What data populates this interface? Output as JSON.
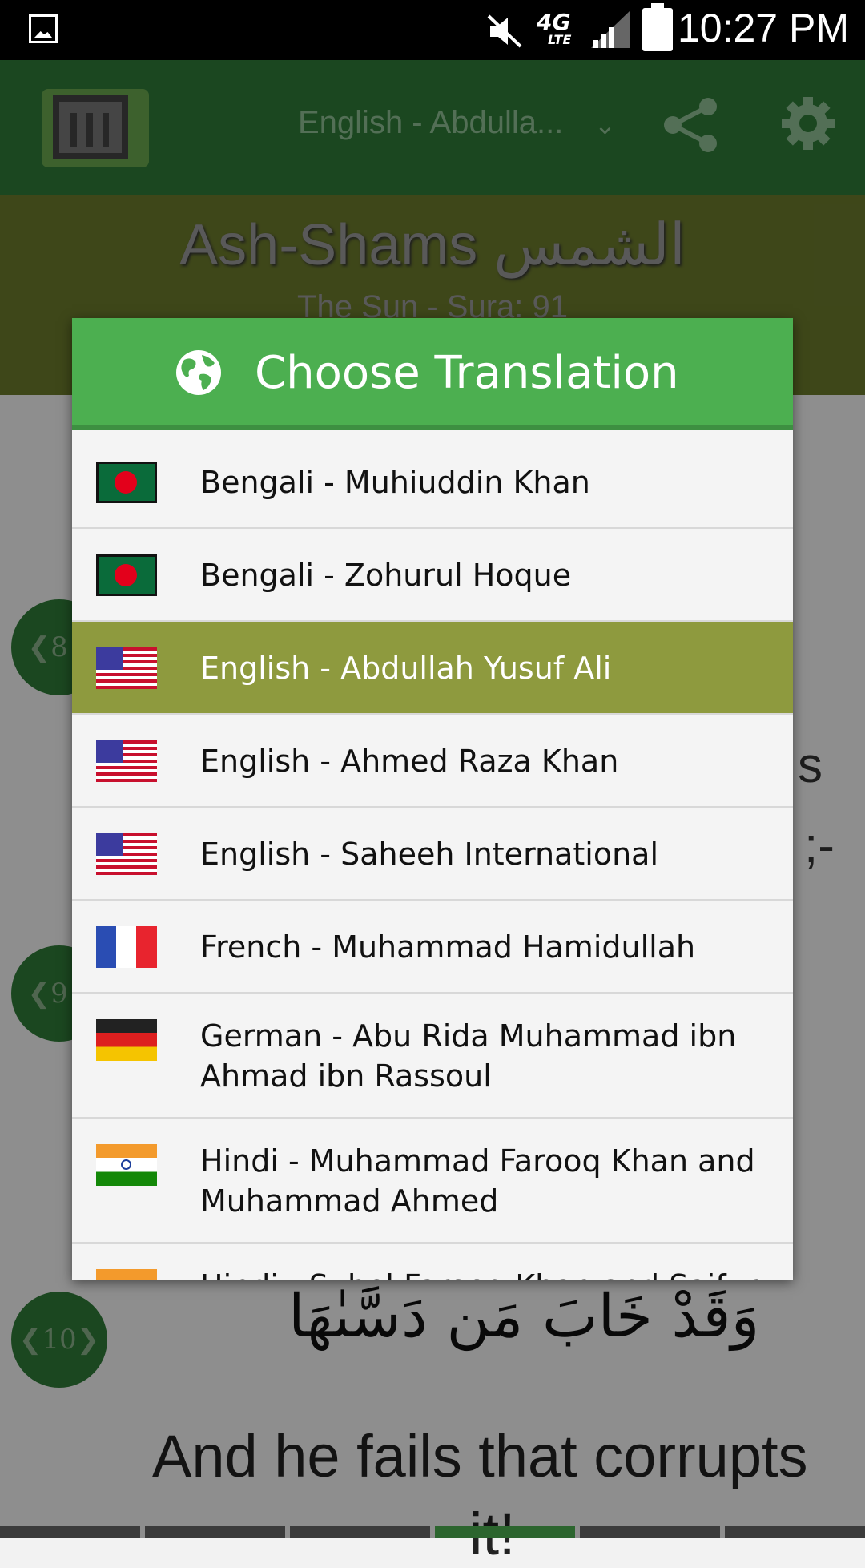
{
  "status_bar": {
    "network": "4G",
    "network_sub": "LTE",
    "time": "10:27 PM"
  },
  "app_bar": {
    "translation_selected": "English - Abdulla..."
  },
  "sura": {
    "title": "Ash-Shams الشمس",
    "subtitle": "The Sun - Sura: 91"
  },
  "background": {
    "ayah_numbers": [
      "8",
      "9",
      "10"
    ],
    "fragment_1": "s",
    "fragment_2": ";-",
    "arabic": "وَقَدْ خَابَ مَن دَسَّىٰهَا",
    "english": "And he fails that corrupts",
    "english_cont": "it!"
  },
  "dialog": {
    "title": "Choose Translation",
    "items": [
      {
        "label": "Bengali - Muhiuddin Khan",
        "flag": "bangladesh",
        "selected": false
      },
      {
        "label": "Bengali - Zohurul Hoque",
        "flag": "bangladesh",
        "selected": false
      },
      {
        "label": "English - Abdullah Yusuf Ali",
        "flag": "usa",
        "selected": true
      },
      {
        "label": "English - Ahmed Raza Khan",
        "flag": "usa",
        "selected": false
      },
      {
        "label": "English - Saheeh International",
        "flag": "usa",
        "selected": false
      },
      {
        "label": "French - Muhammad Hamidullah",
        "flag": "france",
        "selected": false
      },
      {
        "label": "German - Abu Rida Muhammad ibn Ahmad ibn Rassoul",
        "flag": "germany",
        "selected": false
      },
      {
        "label": "Hindi - Muhammad Farooq Khan and Muhammad Ahmed",
        "flag": "india",
        "selected": false
      },
      {
        "label": "Hindi - Suhel Farooq Khan and Saifur",
        "flag": "india",
        "selected": false
      }
    ]
  },
  "colors": {
    "primary": "#2f7a37",
    "dialog_header": "#4caf50",
    "selected_row": "#8e9a3e",
    "sura_header": "#6b7a2c"
  }
}
